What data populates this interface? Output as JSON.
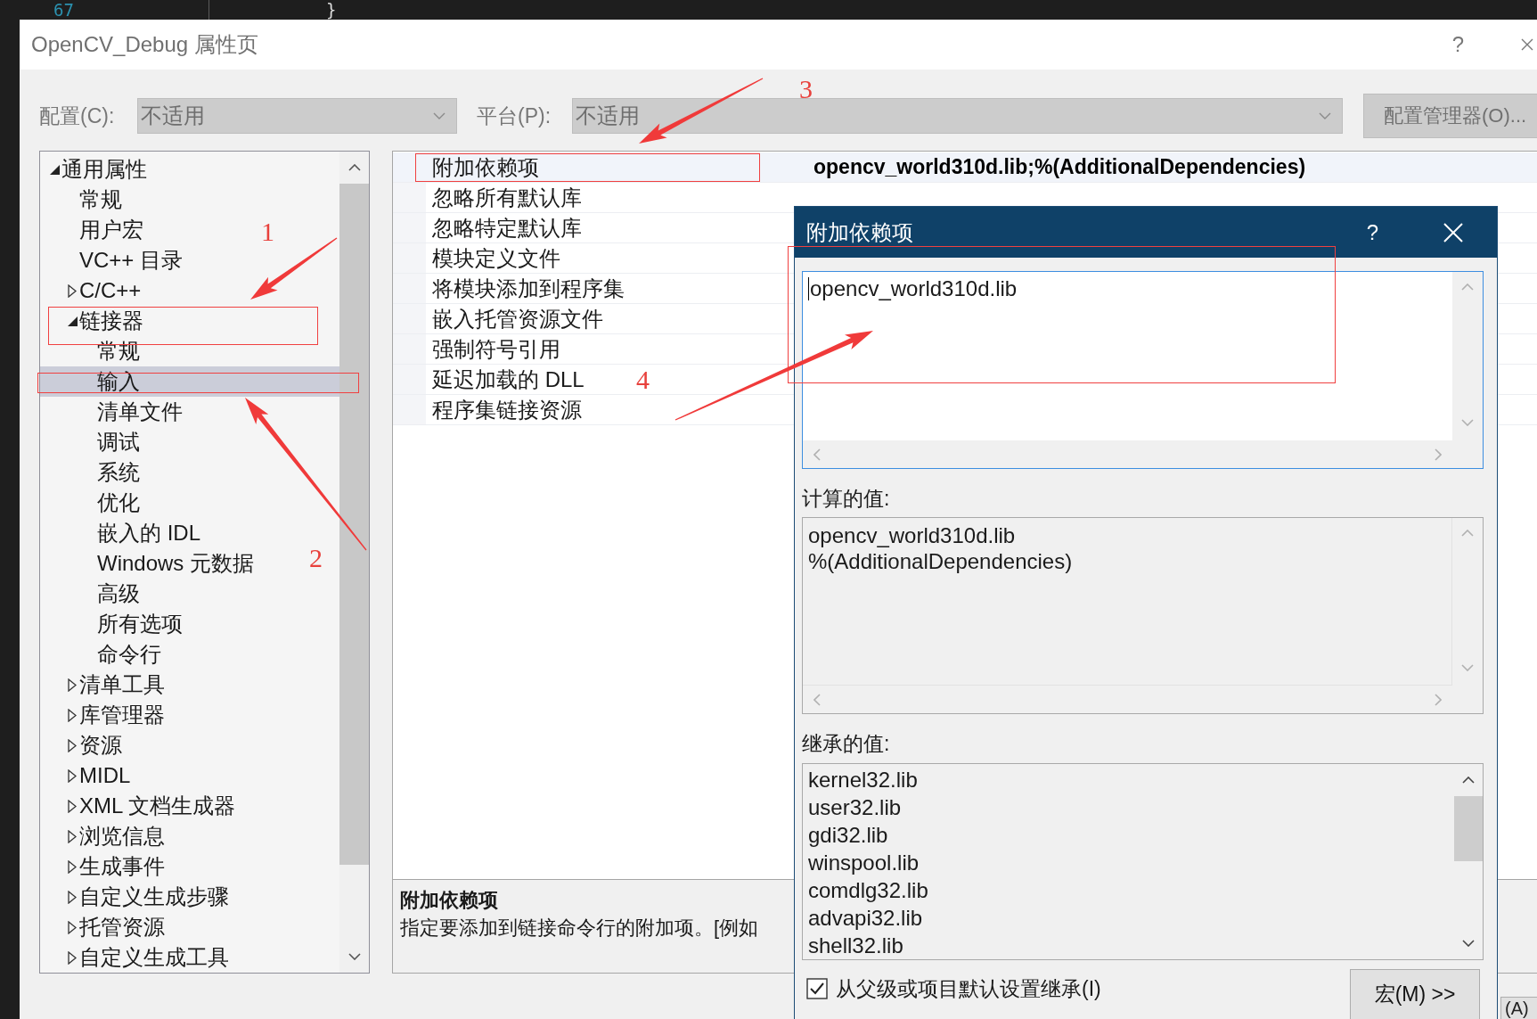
{
  "editor": {
    "line_number": "67",
    "code": "}"
  },
  "window": {
    "title": "OpenCV_Debug 属性页",
    "help": "?"
  },
  "config_bar": {
    "configuration": {
      "label": "配置(C):",
      "value": "不适用",
      "disabled": true
    },
    "platform": {
      "label": "平台(P):",
      "value": "不适用",
      "disabled": true
    },
    "manager_button": {
      "label": "配置管理器(O)...",
      "disabled": true
    }
  },
  "tree": {
    "items": [
      {
        "label": "通用属性",
        "kind": "group",
        "expanded": true,
        "selected": false,
        "children": [
          {
            "label": "常规",
            "kind": "page",
            "selected": false
          },
          {
            "label": "用户宏",
            "kind": "page",
            "selected": false
          },
          {
            "label": "VC++ 目录",
            "kind": "page",
            "selected": false
          },
          {
            "label": "C/C++",
            "kind": "group",
            "expanded": false,
            "selected": false
          },
          {
            "label": "链接器",
            "kind": "group",
            "expanded": true,
            "selected": false,
            "children": [
              {
                "label": "常规",
                "kind": "page",
                "selected": false
              },
              {
                "label": "输入",
                "kind": "page",
                "selected": true
              },
              {
                "label": "清单文件",
                "kind": "page",
                "selected": false
              },
              {
                "label": "调试",
                "kind": "page",
                "selected": false
              },
              {
                "label": "系统",
                "kind": "page",
                "selected": false
              },
              {
                "label": "优化",
                "kind": "page",
                "selected": false
              },
              {
                "label": "嵌入的 IDL",
                "kind": "page",
                "selected": false
              },
              {
                "label": "Windows 元数据",
                "kind": "page",
                "selected": false
              },
              {
                "label": "高级",
                "kind": "page",
                "selected": false
              },
              {
                "label": "所有选项",
                "kind": "page",
                "selected": false
              },
              {
                "label": "命令行",
                "kind": "page",
                "selected": false
              }
            ]
          },
          {
            "label": "清单工具",
            "kind": "group",
            "expanded": false,
            "selected": false
          },
          {
            "label": "库管理器",
            "kind": "group",
            "expanded": false,
            "selected": false
          },
          {
            "label": "资源",
            "kind": "group",
            "expanded": false,
            "selected": false
          },
          {
            "label": "MIDL",
            "kind": "group",
            "expanded": false,
            "selected": false
          },
          {
            "label": "XML 文档生成器",
            "kind": "group",
            "expanded": false,
            "selected": false
          },
          {
            "label": "浏览信息",
            "kind": "group",
            "expanded": false,
            "selected": false
          },
          {
            "label": "生成事件",
            "kind": "group",
            "expanded": false,
            "selected": false
          },
          {
            "label": "自定义生成步骤",
            "kind": "group",
            "expanded": false,
            "selected": false
          },
          {
            "label": "托管资源",
            "kind": "group",
            "expanded": false,
            "selected": false
          },
          {
            "label": "自定义生成工具",
            "kind": "group",
            "expanded": false,
            "selected": false
          }
        ]
      }
    ]
  },
  "property_grid": {
    "rows": [
      {
        "name": "附加依赖项",
        "value": "opencv_world310d.lib;%(AdditionalDependencies)",
        "selected": true
      },
      {
        "name": "忽略所有默认库",
        "selected": false
      },
      {
        "name": "忽略特定默认库",
        "selected": false
      },
      {
        "name": "模块定义文件",
        "selected": false
      },
      {
        "name": "将模块添加到程序集",
        "selected": false
      },
      {
        "name": "嵌入托管资源文件",
        "selected": false
      },
      {
        "name": "强制符号引用",
        "selected": false
      },
      {
        "name": "延迟加载的 DLL",
        "selected": false
      },
      {
        "name": "程序集链接资源",
        "selected": false
      }
    ]
  },
  "description": {
    "title": "附加依赖项",
    "text": "指定要添加到链接命令行的附加项。[例如"
  },
  "apply_button": {
    "label": "(A)"
  },
  "dialog": {
    "title": "附加依赖项",
    "help": "?",
    "edit_box": {
      "lines": [
        "opencv_world310d.lib"
      ],
      "focused": true
    },
    "computed_label": "计算的值:",
    "computed_values": [
      "opencv_world310d.lib",
      "%(AdditionalDependencies)"
    ],
    "inherited_label": "继承的值:",
    "inherited_values": [
      "kernel32.lib",
      "user32.lib",
      "gdi32.lib",
      "winspool.lib",
      "comdlg32.lib",
      "advapi32.lib",
      "shell32.lib"
    ],
    "inherit_checkbox": {
      "label": "从父级或项目默认设置继承(I)",
      "checked": true
    },
    "macros_button": {
      "label": "宏(M) >>"
    }
  },
  "annotations": [
    {
      "number": "1"
    },
    {
      "number": "2"
    },
    {
      "number": "3"
    },
    {
      "number": "4"
    }
  ]
}
